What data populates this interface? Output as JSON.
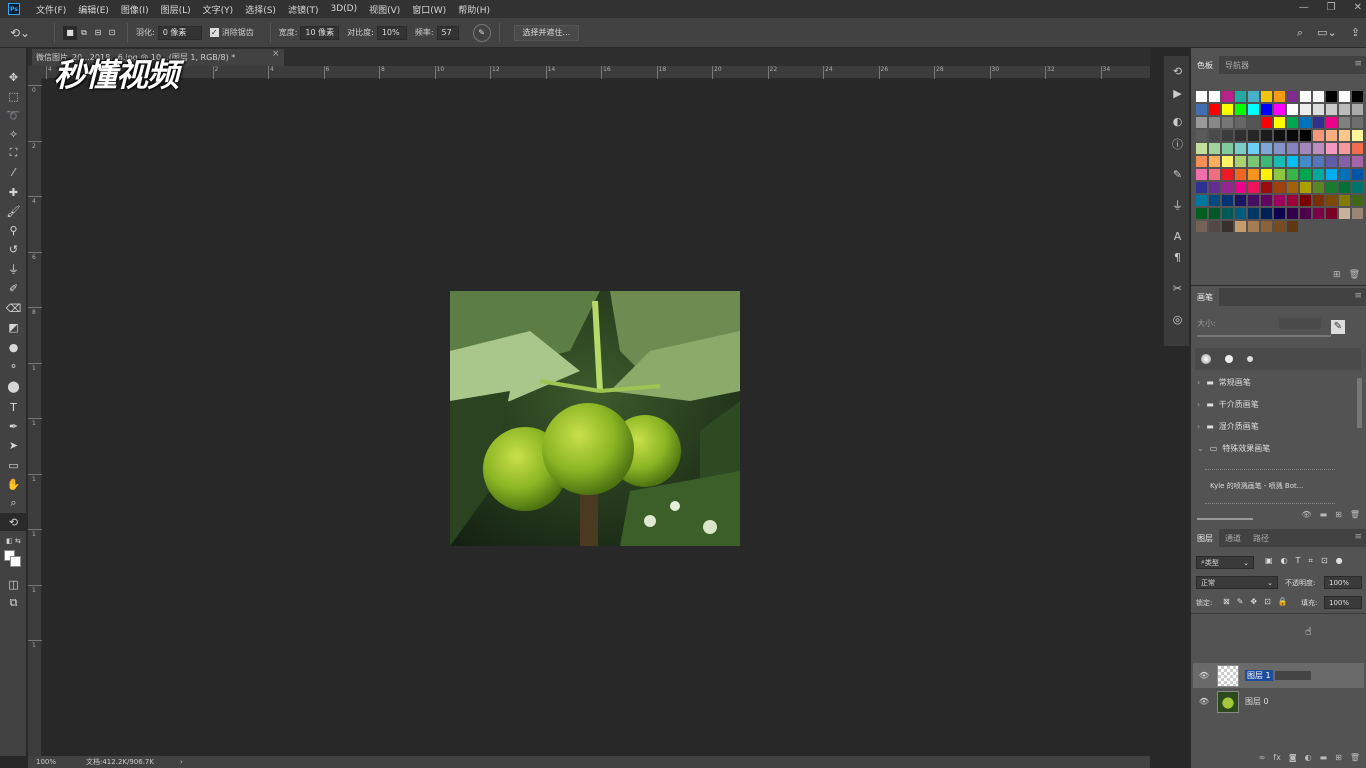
{
  "menubar": {
    "logo": "Ps",
    "items": [
      "文件(F)",
      "编辑(E)",
      "图像(I)",
      "图层(L)",
      "文字(Y)",
      "选择(S)",
      "滤镜(T)",
      "3D(D)",
      "视图(V)",
      "窗口(W)",
      "帮助(H)"
    ],
    "window_controls": {
      "minimize": "—",
      "restore": "❐",
      "close": "✕"
    }
  },
  "options": {
    "feather_label": "羽化:",
    "feather_value": "0 像素",
    "antialias_label": "消除锯齿",
    "antialias_checked": true,
    "width_label": "宽度:",
    "width_value": "10 像素",
    "contrast_label": "对比度:",
    "contrast_value": "10%",
    "frequency_label": "频率:",
    "frequency_value": "57",
    "select_mask_button": "选择并遮住..."
  },
  "document": {
    "tab_title": "微信图片_20...2018...6.jpg @ 10...(图层 1, RGB/8) *",
    "tab_close": "×",
    "ruler_h_labels": [
      "4",
      "2",
      "0",
      "2",
      "4",
      "6",
      "8",
      "10",
      "12",
      "14",
      "16",
      "18",
      "20",
      "22",
      "24",
      "26",
      "28",
      "30",
      "32",
      "34"
    ],
    "ruler_v_labels": [
      "0",
      "2",
      "4",
      "6",
      "8",
      "1",
      "1",
      "1",
      "1",
      "1",
      "1"
    ],
    "watermark": "秒懂视频"
  },
  "status": {
    "zoom": "100%",
    "doc_info": "文档:412.2K/906.7K",
    "arrow": "›"
  },
  "swatches_panel": {
    "tabs": [
      "色板",
      "导航器"
    ],
    "colors": [
      "#ffffff",
      "#ffffff",
      "#b8208b",
      "#23a9a3",
      "#46b1c8",
      "#f1c40f",
      "#f39c12",
      "#7e2d8e",
      "#ffffff",
      "#f8f8f8",
      "#000000",
      "#ffffff",
      "#000000",
      "#3f6fb0",
      "#ff0000",
      "#ffff00",
      "#00ff00",
      "#00ffff",
      "#0000ff",
      "#ff00ff",
      "#ffffff",
      "#eeeeee",
      "#dddddd",
      "#cccccc",
      "#bbbbbb",
      "#aaaaaa",
      "#999999",
      "#888888",
      "#777777",
      "#666666",
      "#555555",
      "#ff0000",
      "#ffff00",
      "#00a651",
      "#0072bc",
      "#2e3192",
      "#ec008c",
      "#808080",
      "#6e6e6e",
      "#5a5a5a",
      "#4a4a4a",
      "#3c3c3c",
      "#303030",
      "#262626",
      "#1c1c1c",
      "#111111",
      "#090909",
      "#000000",
      "#f7977a",
      "#f9ad81",
      "#fdc68a",
      "#fff79a",
      "#c4df9b",
      "#a3d39c",
      "#82ca9d",
      "#7bcdc8",
      "#6ecff6",
      "#7ea7d8",
      "#8493ca",
      "#8882be",
      "#a187be",
      "#bc8dbf",
      "#f49ac2",
      "#f6989d",
      "#f26c4f",
      "#f68e55",
      "#fbaf5c",
      "#fff467",
      "#acd372",
      "#7cc576",
      "#3bb878",
      "#1abbb4",
      "#00bff3",
      "#438ccb",
      "#5574b9",
      "#605ca8",
      "#855fa8",
      "#a763a8",
      "#f06ea9",
      "#f26d7d",
      "#ed1c24",
      "#f26522",
      "#f7941d",
      "#fff200",
      "#8dc73f",
      "#39b54a",
      "#00a651",
      "#00a99d",
      "#00aeef",
      "#0072bc",
      "#0054a6",
      "#2e3192",
      "#662d91",
      "#92278f",
      "#ec008c",
      "#ed145b",
      "#9e0b0f",
      "#a0410d",
      "#a36209",
      "#aba000",
      "#598527",
      "#1a7b30",
      "#007236",
      "#00746b",
      "#0076a3",
      "#004a80",
      "#003471",
      "#1b1464",
      "#440e62",
      "#630460",
      "#9e005d",
      "#9e0039",
      "#790000",
      "#7b2e00",
      "#7d4900",
      "#827b00",
      "#406618",
      "#005e20",
      "#005826",
      "#005952",
      "#005b7f",
      "#003663",
      "#002157",
      "#0d004c",
      "#32004b",
      "#4b0049",
      "#7b0046",
      "#7a0026",
      "#c7b299",
      "#998675",
      "#736357",
      "#534741",
      "#37302a",
      "#c69c6d",
      "#a67c52",
      "#8c6239",
      "#754c24",
      "#603913"
    ],
    "footer_icons": [
      "new-swatch-icon",
      "trash-icon"
    ]
  },
  "brushes_panel": {
    "tabs": [
      "画笔"
    ],
    "size_label": "大小:",
    "folders": [
      {
        "label": "常规画笔",
        "open": false
      },
      {
        "label": "干介质画笔",
        "open": false
      },
      {
        "label": "湿介质画笔",
        "open": false
      },
      {
        "label": "特殊效果画笔",
        "open": true
      }
    ],
    "brush_item": "Kyle 的喷溅画笔 - 喷溅 Bot..."
  },
  "layers_panel": {
    "tabs": [
      "图层",
      "通道",
      "路径"
    ],
    "filter_label": "类型",
    "blend_mode": "正常",
    "opacity_label": "不透明度:",
    "opacity_value": "100%",
    "lock_label": "锁定:",
    "fill_label": "填充:",
    "fill_value": "100%",
    "layers": [
      {
        "name": "图层 1",
        "visible": true,
        "selected": true,
        "editing": true
      },
      {
        "name": "图层 0",
        "visible": true,
        "selected": false,
        "editing": false
      }
    ],
    "footer_icons": [
      "link-icon",
      "fx-icon",
      "mask-icon",
      "adjustment-icon",
      "folder-icon",
      "new-layer-icon",
      "trash-icon"
    ]
  }
}
